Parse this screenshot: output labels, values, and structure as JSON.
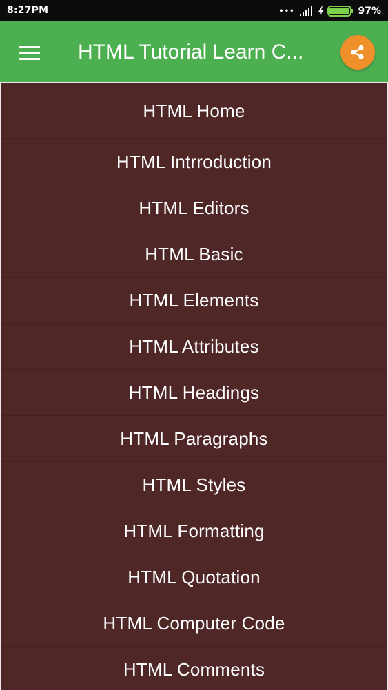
{
  "status_bar": {
    "time": "8:27PM",
    "dots": "•••",
    "battery_percent": "97%",
    "battery_level": 0.97,
    "icons": [
      "signal-icon",
      "charging-bolt-icon",
      "battery-icon"
    ]
  },
  "app_bar": {
    "title": "HTML Tutorial Learn C...",
    "menu_icon": "hamburger-menu-icon",
    "share_icon": "share-icon",
    "color": "#4caf50",
    "share_color": "#f0902a"
  },
  "list": {
    "background": "#4f2727",
    "items": [
      "HTML Home",
      "HTML Intrroduction",
      "HTML Editors",
      "HTML Basic",
      "HTML Elements",
      "HTML Attributes",
      "HTML Headings",
      "HTML Paragraphs",
      "HTML Styles",
      "HTML Formatting",
      "HTML Quotation",
      "HTML Computer Code",
      "HTML Comments"
    ]
  }
}
